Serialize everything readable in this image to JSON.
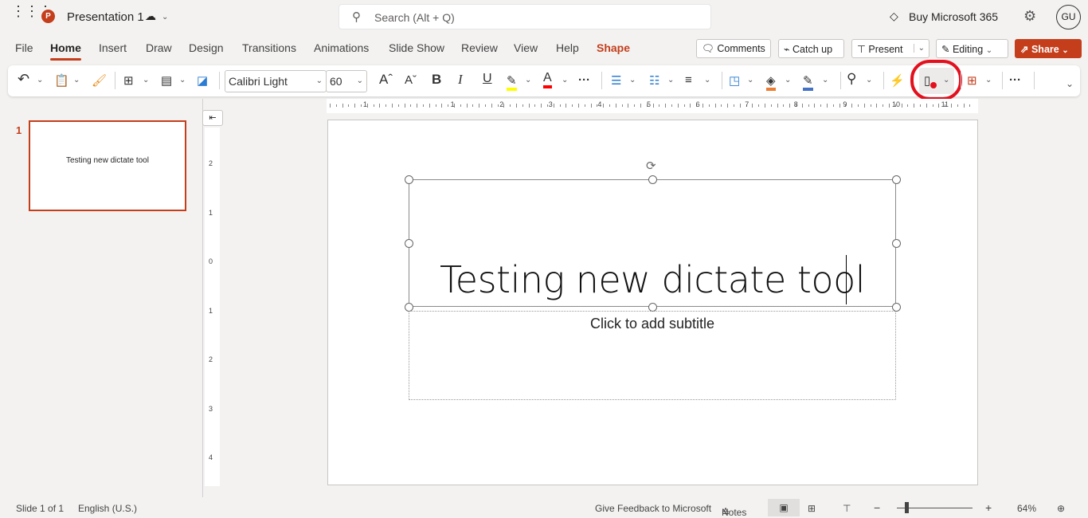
{
  "app": {
    "title": "Presentation 1",
    "search_placeholder": "Search (Alt + Q)",
    "buy": "Buy Microsoft 365",
    "avatar": "GU"
  },
  "tabs": [
    {
      "label": "File"
    },
    {
      "label": "Home"
    },
    {
      "label": "Insert"
    },
    {
      "label": "Draw"
    },
    {
      "label": "Design"
    },
    {
      "label": "Transitions"
    },
    {
      "label": "Animations"
    },
    {
      "label": "Slide Show"
    },
    {
      "label": "Review"
    },
    {
      "label": "View"
    },
    {
      "label": "Help"
    },
    {
      "label": "Shape"
    }
  ],
  "actions": {
    "comments": "Comments",
    "catchup": "Catch up",
    "present": "Present",
    "editing": "Editing",
    "share": "Share"
  },
  "ribbon": {
    "font": "Calibri Light",
    "size": "60"
  },
  "colors": {
    "accent": "#c43e1c",
    "highlight": "#ffff00",
    "font_color": "#ff0000",
    "dictate_highlight": "#e3101e"
  },
  "thumbnail": {
    "number": "1",
    "text": "Testing new dictate tool"
  },
  "slide": {
    "title": "Testing new dictate tool",
    "subtitle_placeholder": "Click to add subtitle"
  },
  "ruler": {
    "h": [
      "1",
      "1",
      "2",
      "3",
      "4",
      "5",
      "6",
      "7",
      "8",
      "9",
      "10",
      "11"
    ],
    "v": [
      "2",
      "1",
      "0",
      "1",
      "2",
      "3",
      "4"
    ]
  },
  "status": {
    "slide": "Slide 1 of 1",
    "language": "English (U.S.)",
    "feedback": "Give Feedback to Microsoft",
    "notes": "Notes",
    "zoom": "64%",
    "zoom_level": 64
  }
}
